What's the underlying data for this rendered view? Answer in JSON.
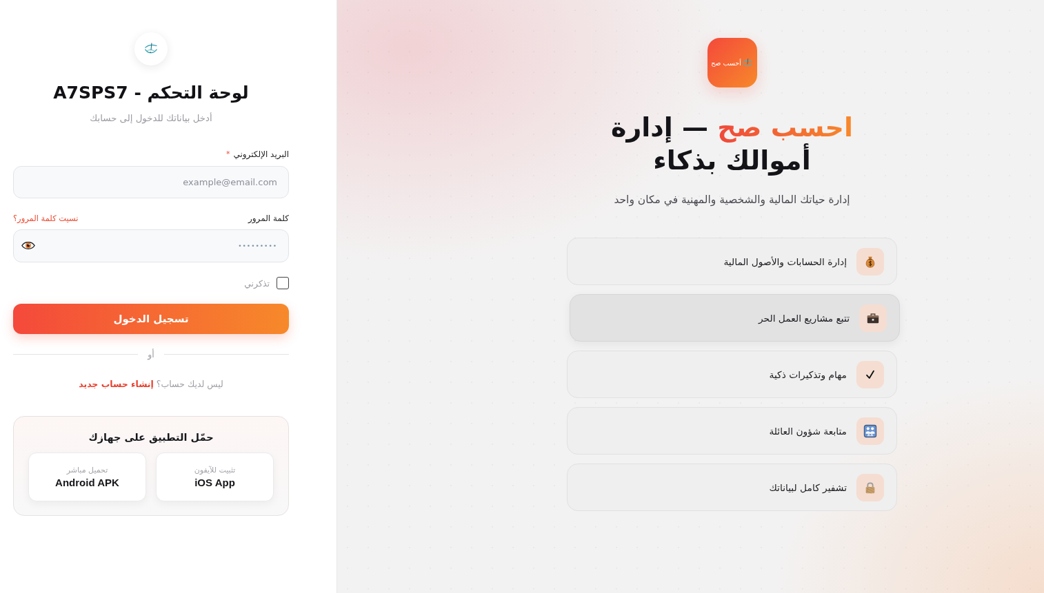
{
  "login": {
    "title": "لوحة التحكم - A7SPS7",
    "subtitle": "أدخل بياناتك للدخول إلى حسابك",
    "email": {
      "label": "البريد الإلكتروني",
      "required_mark": "*",
      "placeholder": "example@email.com"
    },
    "password": {
      "label": "كلمة المرور",
      "forgot_link": "نسيت كلمة المرور؟",
      "placeholder": "•••••••••"
    },
    "remember": {
      "label": "تذكرني",
      "checked": false
    },
    "submit": "تسجيل الدخول",
    "divider": "أو",
    "signup": {
      "prompt": "ليس لديك حساب؟",
      "link": "إنشاء حساب جديد"
    },
    "install": {
      "title": "حمّل التطبيق على جهازك",
      "options": [
        {
          "caption": "تثبيت للآيفون",
          "title": "iOS App"
        },
        {
          "caption": "تحميل مباشر",
          "title": "Android APK"
        }
      ]
    }
  },
  "hero": {
    "logo_text": "أحسب صح",
    "title": {
      "highlight": "احسب صح",
      "line_1": "— إدارة",
      "line_2": "أموالك بذكاء"
    },
    "subtitle": "إدارة حياتك المالية والشخصية والمهنية في مكان واحد",
    "features": [
      {
        "label": "إدارة الحسابات والأصول المالية",
        "hovered": false
      },
      {
        "label": "تتبع مشاريع العمل الحر",
        "hovered": true
      },
      {
        "label": "مهام وتذكيرات ذكية",
        "hovered": false
      },
      {
        "label": "متابعة شؤون العائلة",
        "hovered": false
      },
      {
        "label": "تشفير كامل لبياناتك",
        "hovered": false
      }
    ]
  }
}
